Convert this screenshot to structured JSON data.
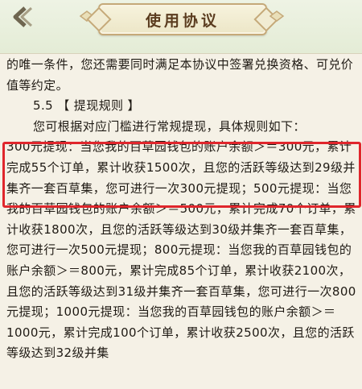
{
  "header": {
    "title": "使用协议",
    "back_icon": "back-arrow-icon"
  },
  "content": {
    "line_1": "的唯一条件，您还需要同时满足本协议中签署兑换资格、可兑价值等约定。",
    "section_heading": "5.5 【 提现规则 】",
    "intro": "您可根据对应门槛进行常规提现，具体规则如下：",
    "rule_300": "300元提现：当您我的百草园钱包的账户余额＞＝300元，累计完成55个订单，累计收获1500次，且您的活跃等级达到29级并集齐一套百草集，您可进行一次300元提现；",
    "rule_500": "500元提现：当您我的百草园钱包的账户余额＞＝500元，累计完成70个订单，累计收获1800次，且您的活跃等级达到30级并集齐一套百草集，您可进行一次500元提现；",
    "rule_800": "800元提现：当您我的百草园钱包的账户余额＞＝800元，累计完成85个订单，累计收获2100次，且您的活跃等级达到31级并集齐一套百草集，您可进行一次800元提现；",
    "rule_1000": "1000元提现：当您我的百草园钱包的账户余额＞＝1000元，累计完成100个订单，累计收获2500次，且您的活跃等级达到32级并集"
  },
  "colors": {
    "highlight": "#e0262c",
    "accent": "#5b3d20"
  }
}
